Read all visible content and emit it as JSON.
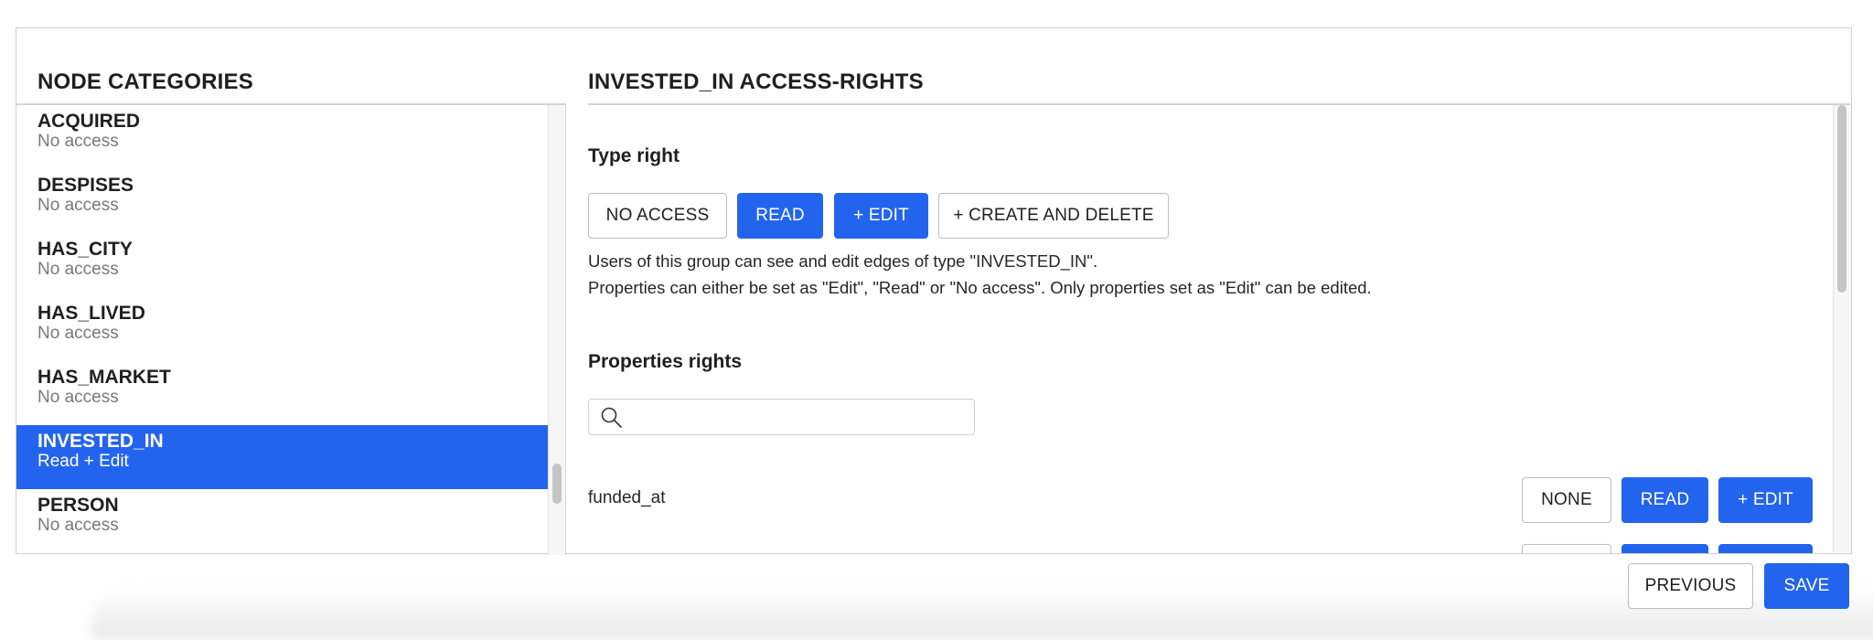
{
  "left_panel": {
    "title": "NODE CATEGORIES",
    "items": [
      {
        "name": "ACQUIRED",
        "status": "No access",
        "selected": false
      },
      {
        "name": "DESPISES",
        "status": "No access",
        "selected": false
      },
      {
        "name": "HAS_CITY",
        "status": "No access",
        "selected": false
      },
      {
        "name": "HAS_LIVED",
        "status": "No access",
        "selected": false
      },
      {
        "name": "HAS_MARKET",
        "status": "No access",
        "selected": false
      },
      {
        "name": "INVESTED_IN",
        "status": "Read + Edit",
        "selected": true
      },
      {
        "name": "PERSON",
        "status": "No access",
        "selected": false
      }
    ]
  },
  "right_panel": {
    "title": "INVESTED_IN ACCESS-RIGHTS",
    "type_right": {
      "heading": "Type right",
      "buttons": [
        {
          "label": "NO ACCESS",
          "active": false
        },
        {
          "label": "READ",
          "active": true
        },
        {
          "label": "+ EDIT",
          "active": true
        },
        {
          "label": "+ CREATE AND DELETE",
          "active": false
        }
      ],
      "description_line1": "Users of this group can see and edit edges of type \"INVESTED_IN\".",
      "description_line2": "Properties can either be set as \"Edit\", \"Read\" or \"No access\". Only properties set as \"Edit\" can be edited."
    },
    "properties_rights": {
      "heading": "Properties rights",
      "search": {
        "value": "",
        "placeholder": "",
        "icon": "search-icon"
      },
      "properties": [
        {
          "name": "funded_at",
          "buttons": [
            {
              "label": "NONE",
              "active": false
            },
            {
              "label": "READ",
              "active": true
            },
            {
              "label": "+ EDIT",
              "active": true
            }
          ]
        },
        {
          "name": "",
          "buttons": [
            {
              "label": "",
              "active": false
            },
            {
              "label": "",
              "active": true
            },
            {
              "label": "",
              "active": true
            }
          ]
        }
      ]
    }
  },
  "footer": {
    "previous_label": "PREVIOUS",
    "save_label": "SAVE"
  },
  "colors": {
    "accent": "#2364ef",
    "border": "#cfcfcf",
    "muted_text": "#7a7a7a"
  }
}
